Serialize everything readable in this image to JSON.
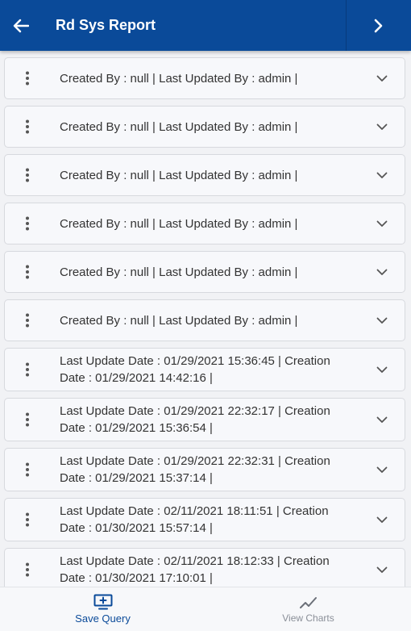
{
  "header": {
    "title": "Rd Sys Report"
  },
  "rows": [
    "Created By  : null | Last Updated By  : admin |",
    "Created By  : null | Last Updated By  : admin |",
    "Created By  : null | Last Updated By  : admin |",
    "Created By  : null | Last Updated By  : admin |",
    "Created By  : null | Last Updated By  : admin |",
    "Created By  : null | Last Updated By  : admin |",
    "Last Update Date  : 01/29/2021 15:36:45 | Creation Date  : 01/29/2021 14:42:16 |",
    "Last Update Date  : 01/29/2021 22:32:17 | Creation Date  : 01/29/2021 15:36:54 |",
    "Last Update Date  : 01/29/2021 22:32:31 | Creation Date  : 01/29/2021 15:37:14 |",
    "Last Update Date  : 02/11/2021 18:11:51 | Creation Date  : 01/30/2021 15:57:14 |",
    "Last Update Date  : 02/11/2021 18:12:33 | Creation Date  : 01/30/2021 17:10:01 |"
  ],
  "bottom": {
    "save_label": "Save Query",
    "charts_label": "View Charts"
  },
  "icons": {
    "back": "arrow-left-icon",
    "next": "chevron-right-icon",
    "row_menu": "kebab-menu-icon",
    "row_expand": "chevron-down-icon",
    "save": "monitor-plus-icon",
    "charts": "line-chart-icon"
  },
  "colors": {
    "appbar": "#0a4a99",
    "active_tab": "#0a4a99",
    "inactive_tab": "#8a8f98"
  }
}
